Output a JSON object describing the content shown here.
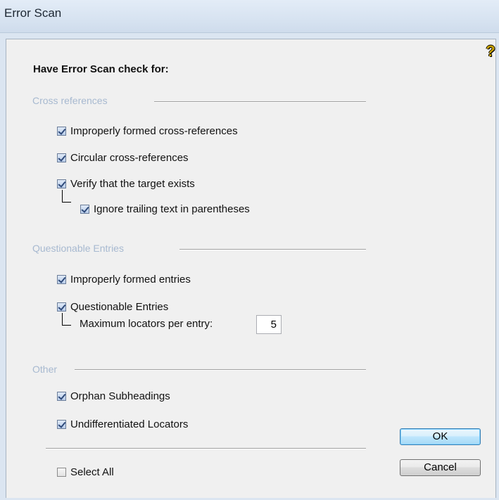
{
  "window": {
    "title": "Error Scan"
  },
  "heading": "Have Error Scan check for:",
  "groups": {
    "cross_references": {
      "label": "Cross references",
      "items": {
        "improper_xref": {
          "label": "Improperly formed cross-references",
          "checked": true
        },
        "circular_xref": {
          "label": "Circular cross-references",
          "checked": true
        },
        "verify_target": {
          "label": "Verify that the target exists",
          "checked": true
        },
        "ignore_trailing": {
          "label": "Ignore trailing text in parentheses",
          "checked": true
        }
      }
    },
    "questionable_entries": {
      "label": "Questionable Entries",
      "items": {
        "improper_entries": {
          "label": "Improperly formed entries",
          "checked": true
        },
        "questionable": {
          "label": "Questionable Entries",
          "checked": true
        }
      },
      "max_locators": {
        "label": "Maximum locators per entry:",
        "value": "5"
      }
    },
    "other": {
      "label": "Other",
      "items": {
        "orphan_subheadings": {
          "label": "Orphan Subheadings",
          "checked": true
        },
        "undifferentiated_locators": {
          "label": "Undifferentiated Locators",
          "checked": true
        }
      }
    }
  },
  "select_all": {
    "label": "Select All",
    "checked": false
  },
  "buttons": {
    "ok": "OK",
    "cancel": "Cancel"
  },
  "icons": {
    "help": "help-question-icon"
  },
  "colors": {
    "group_label": "#a7b9d0",
    "titlebar": "#d7e3f1",
    "dialog_bg": "#f0f0f0",
    "default_button_border": "#3c7fb1"
  }
}
